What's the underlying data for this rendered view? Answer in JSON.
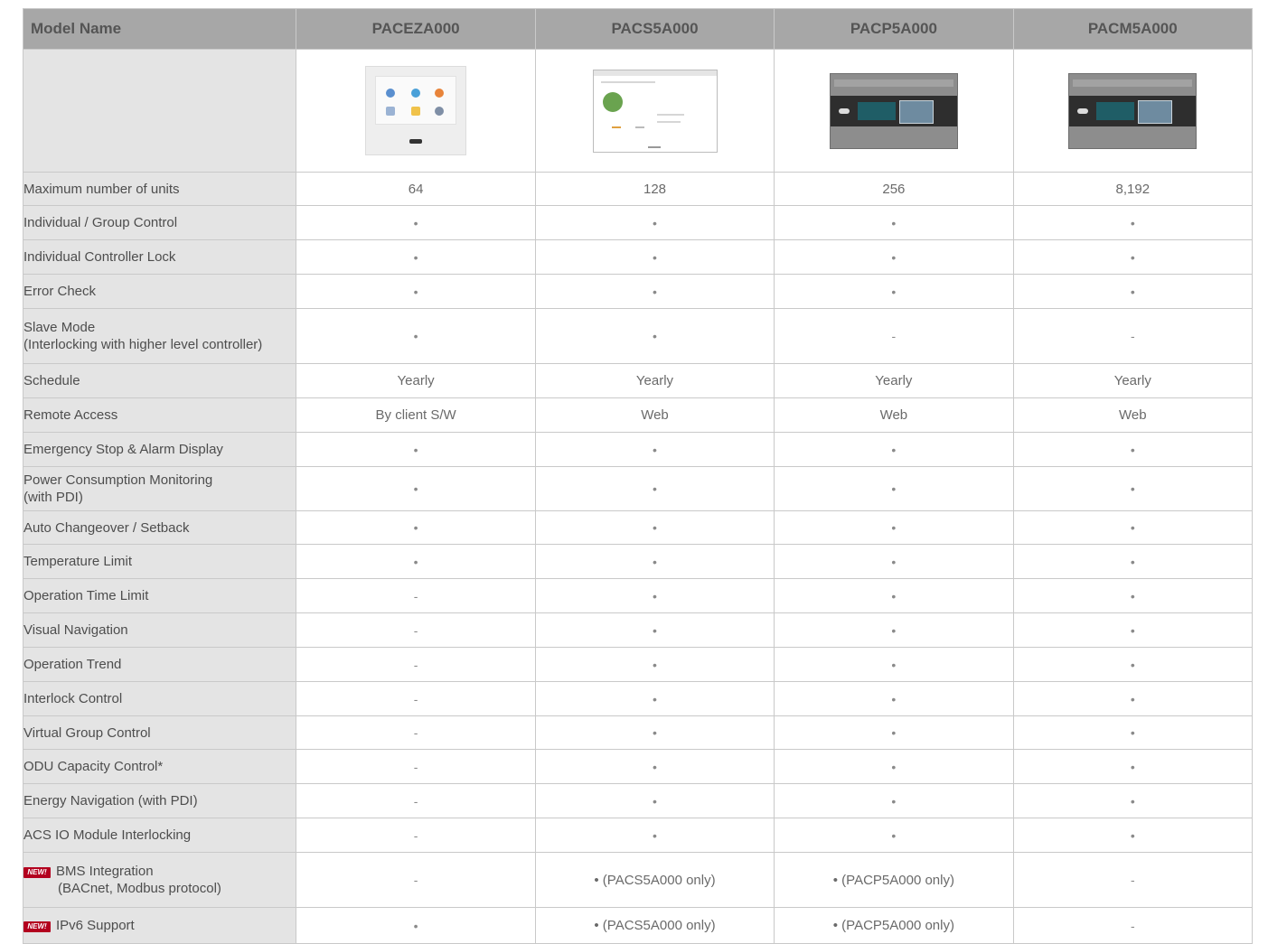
{
  "header": {
    "first": "Model Name",
    "models": [
      "PACEZA000",
      "PACS5A000",
      "PACP5A000",
      "PACM5A000"
    ]
  },
  "images": [
    {
      "icon": "touch-panel-controller-image"
    },
    {
      "icon": "software-screen-image"
    },
    {
      "icon": "rack-controller-image"
    },
    {
      "icon": "rack-controller-image"
    }
  ],
  "badge": "NEW!",
  "rows": [
    {
      "label": "Maximum number of units",
      "values": [
        "64",
        "128",
        "256",
        "8,192"
      ]
    },
    {
      "label": "Individual / Group Control",
      "values": [
        "•",
        "•",
        "•",
        "•"
      ]
    },
    {
      "label": "Individual Controller Lock",
      "values": [
        "•",
        "•",
        "•",
        "•"
      ]
    },
    {
      "label": "Error Check",
      "values": [
        "•",
        "•",
        "•",
        "•"
      ]
    },
    {
      "label": "Slave Mode",
      "label2": "(Interlocking with higher level controller)",
      "values": [
        "•",
        "•",
        "-",
        "-"
      ]
    },
    {
      "label": "Schedule",
      "values": [
        "Yearly",
        "Yearly",
        "Yearly",
        "Yearly"
      ]
    },
    {
      "label": "Remote Access",
      "values": [
        "By client S/W",
        "Web",
        "Web",
        "Web"
      ]
    },
    {
      "label": "Emergency Stop & Alarm Display",
      "values": [
        "•",
        "•",
        "•",
        "•"
      ]
    },
    {
      "label": "Power Consumption Monitoring",
      "label2": "(with PDI)",
      "values": [
        "•",
        "•",
        "•",
        "•"
      ]
    },
    {
      "label": "Auto Changeover / Setback",
      "values": [
        "•",
        "•",
        "•",
        "•"
      ]
    },
    {
      "label": "Temperature Limit",
      "values": [
        "•",
        "•",
        "•",
        "•"
      ]
    },
    {
      "label": "Operation Time Limit",
      "values": [
        "-",
        "•",
        "•",
        "•"
      ]
    },
    {
      "label": "Visual Navigation",
      "values": [
        "-",
        "•",
        "•",
        "•"
      ]
    },
    {
      "label": "Operation Trend",
      "values": [
        "-",
        "•",
        "•",
        "•"
      ]
    },
    {
      "label": "Interlock Control",
      "values": [
        "-",
        "•",
        "•",
        "•"
      ]
    },
    {
      "label": "Virtual Group Control",
      "values": [
        "-",
        "•",
        "•",
        "•"
      ]
    },
    {
      "label": "ODU Capacity Control*",
      "values": [
        "-",
        "•",
        "•",
        "•"
      ]
    },
    {
      "label": "Energy Navigation (with PDI)",
      "values": [
        "-",
        "•",
        "•",
        "•"
      ]
    },
    {
      "label": "ACS IO Module Interlocking",
      "values": [
        "-",
        "•",
        "•",
        "•"
      ]
    },
    {
      "label": "BMS Integration",
      "label2": "(BACnet, Modbus protocol)",
      "new": true,
      "values": [
        "-",
        "• (PACS5A000 only)",
        "• (PACP5A000 only)",
        "-"
      ]
    },
    {
      "label": "IPv6 Support",
      "new": true,
      "values": [
        "•",
        "• (PACS5A000 only)",
        "• (PACP5A000 only)",
        "-"
      ]
    }
  ]
}
